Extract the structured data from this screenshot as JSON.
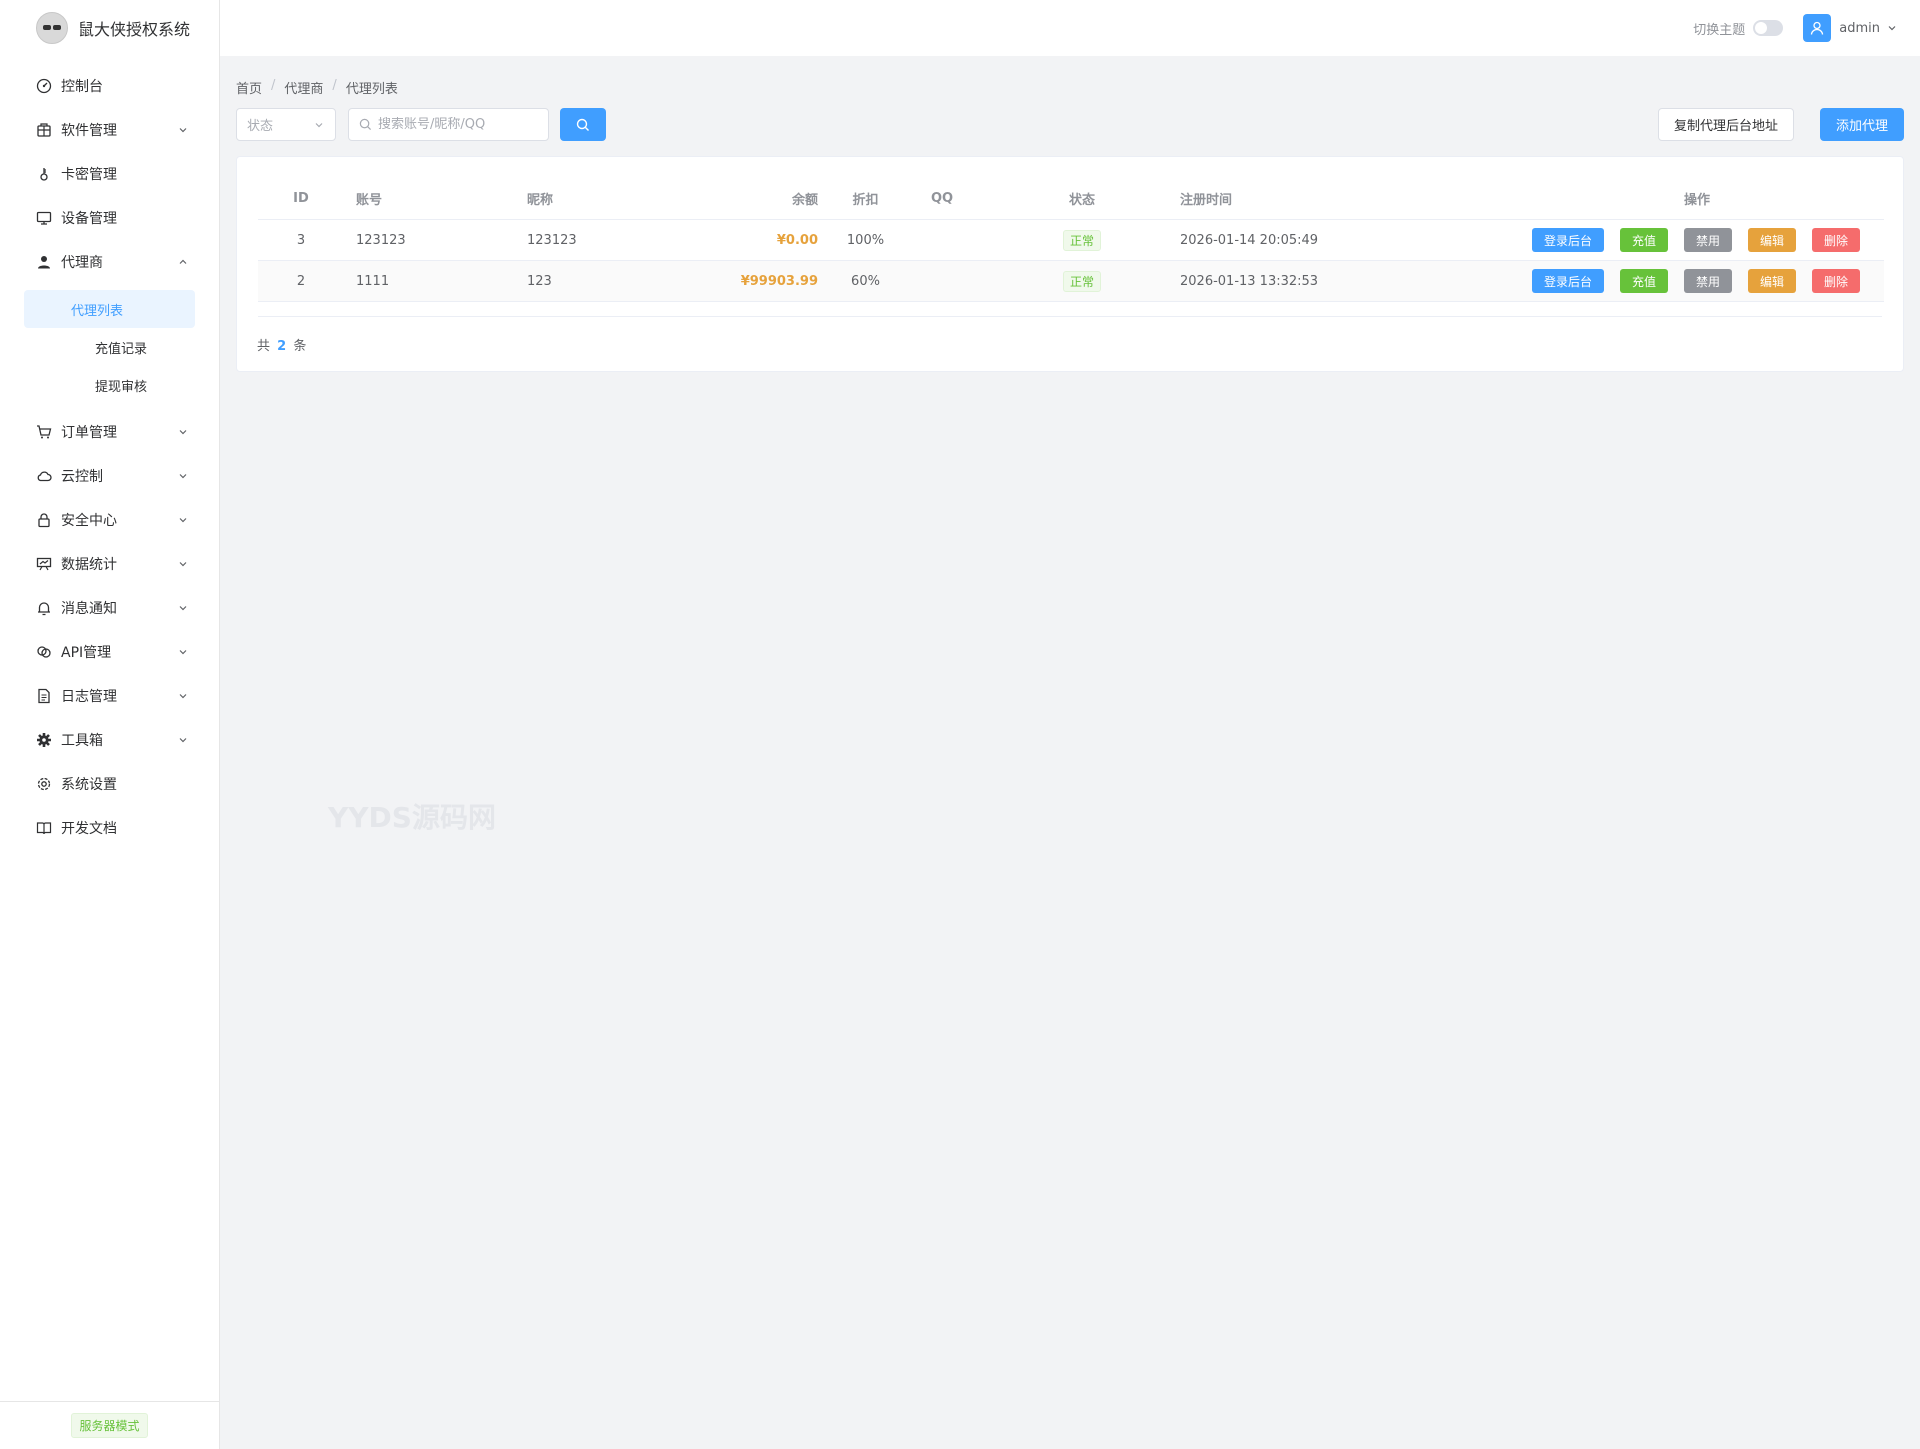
{
  "app": {
    "title": "鼠大侠授权系统"
  },
  "sidebar": {
    "items": [
      {
        "label": "控制台",
        "icon": "dashboard-icon",
        "expandable": false
      },
      {
        "label": "软件管理",
        "icon": "package-icon",
        "expandable": true
      },
      {
        "label": "卡密管理",
        "icon": "key-icon",
        "expandable": false
      },
      {
        "label": "设备管理",
        "icon": "monitor-icon",
        "expandable": false
      },
      {
        "label": "代理商",
        "icon": "user-icon",
        "expandable": true,
        "expanded": true,
        "children": [
          {
            "label": "代理列表",
            "active": true
          },
          {
            "label": "充值记录"
          },
          {
            "label": "提现审核"
          }
        ]
      },
      {
        "label": "订单管理",
        "icon": "cart-icon",
        "expandable": true
      },
      {
        "label": "云控制",
        "icon": "cloud-icon",
        "expandable": true
      },
      {
        "label": "安全中心",
        "icon": "lock-icon",
        "expandable": true
      },
      {
        "label": "数据统计",
        "icon": "chart-board-icon",
        "expandable": true
      },
      {
        "label": "消息通知",
        "icon": "bell-icon",
        "expandable": true
      },
      {
        "label": "API管理",
        "icon": "link-icon",
        "expandable": true
      },
      {
        "label": "日志管理",
        "icon": "document-icon",
        "expandable": true
      },
      {
        "label": "工具箱",
        "icon": "cog-icon",
        "expandable": true
      },
      {
        "label": "系统设置",
        "icon": "settings-icon",
        "expandable": false
      },
      {
        "label": "开发文档",
        "icon": "book-icon",
        "expandable": false
      }
    ],
    "footer_badge": "服务器模式"
  },
  "header": {
    "theme_label": "切换主题",
    "theme_dark": false,
    "user_name": "admin"
  },
  "breadcrumb": [
    "首页",
    "代理商",
    "代理列表"
  ],
  "toolbar": {
    "status_placeholder": "状态",
    "search_placeholder": "搜索账号/昵称/QQ",
    "copy_label": "复制代理后台地址",
    "add_label": "添加代理"
  },
  "table": {
    "columns": [
      "ID",
      "账号",
      "昵称",
      "余额",
      "折扣",
      "QQ",
      "状态",
      "注册时间",
      "操作"
    ],
    "rows": [
      {
        "id": "3",
        "account": "123123",
        "nickname": "123123",
        "balance": "¥0.00",
        "discount": "100%",
        "qq": "",
        "status": "正常",
        "reg_time": "2026-01-14 20:05:49"
      },
      {
        "id": "2",
        "account": "1111",
        "nickname": "123",
        "balance": "¥99903.99",
        "discount": "60%",
        "qq": "",
        "status": "正常",
        "reg_time": "2026-01-13 13:32:53"
      }
    ],
    "actions": {
      "login": "登录后台",
      "charge": "充值",
      "ban": "禁用",
      "edit": "编辑",
      "delete": "删除"
    }
  },
  "pager": {
    "prefix": "共",
    "total": "2",
    "suffix": "条"
  },
  "watermark": "YYDS源码网",
  "colors": {
    "primary": "#409eff",
    "success": "#67c23a",
    "warning": "#e6a23c",
    "danger": "#f56c6c",
    "info": "#909399"
  }
}
